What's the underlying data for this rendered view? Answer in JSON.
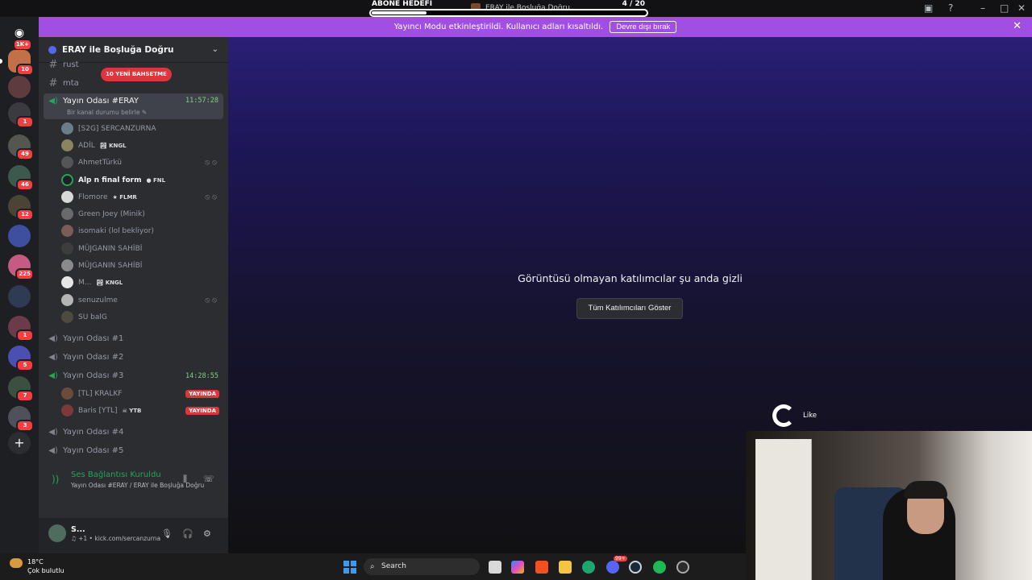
{
  "overlay": {
    "goal_label": "ABONE HEDEFİ",
    "goal_server": "ERAY ile Boşluğa Doğru",
    "goal_count": "4   / 20",
    "goal_progress": 0.2
  },
  "banner": {
    "text": "Yayıncı Modu etkinleştirildi. Kullanıcı adları kısaltıldı.",
    "button": "Devre dışı bırak",
    "close": "✕"
  },
  "rail": {
    "top_badge": "1K+",
    "badges": [
      "10",
      "1",
      "49",
      "46",
      "12",
      "225",
      "1",
      "5",
      "7",
      "3"
    ]
  },
  "sidebar": {
    "server_name": "ERAY ile Boşluğa Doğru",
    "mention_pill": "10 YENİ BAHSETME",
    "channels": [
      {
        "name": "rust"
      },
      {
        "name": "mta"
      }
    ],
    "active_voice": {
      "name": "Yayın Odası #ERAY",
      "time": "11:57:28",
      "status": "Bir kanal durumu belirle"
    },
    "users": [
      {
        "name": "[S2G] SERCANZURNA",
        "tag": ""
      },
      {
        "name": "ADİL",
        "tag": "KNGL"
      },
      {
        "name": "AhmetTürkü",
        "tag": ""
      },
      {
        "name": "Alp n final form",
        "tag": "FNL"
      },
      {
        "name": "Flomore",
        "tag": "FLMR"
      },
      {
        "name": "Green Joey (Minik)",
        "tag": ""
      },
      {
        "name": "isomaki (lol bekliyor)",
        "tag": ""
      },
      {
        "name": "MÜJGANIN SAHİBİ",
        "tag": ""
      },
      {
        "name": "MÜJGANIN SAHİBİ",
        "tag": ""
      },
      {
        "name": "M...",
        "tag": "KNGL"
      },
      {
        "name": "senuzulme",
        "tag": ""
      },
      {
        "name": "SU balG",
        "tag": ""
      }
    ],
    "voice_channels": [
      {
        "name": "Yayın Odası #1"
      },
      {
        "name": "Yayın Odası #2"
      },
      {
        "name": "Yayın Odası #3",
        "time": "14:28:55"
      },
      {
        "name": "Yayın Odası #4"
      },
      {
        "name": "Yayın Odası #5"
      }
    ],
    "room3_users": [
      {
        "name": "[TL] KRALKF",
        "live": "YAYINDA"
      },
      {
        "name": "Baris [YTL]",
        "tag": "YTB",
        "live": "YAYINDA"
      }
    ]
  },
  "voice_panel": {
    "status": "Ses Bağlantısı Kuruldu",
    "channel": "Yayın Odası #ERAY / ERAY ile Boşluğa Doğru"
  },
  "user_panel": {
    "name": "S...",
    "activity": "♫ +1 • kick.com/sercanzurna"
  },
  "stage": {
    "message": "Görüntüsü olmayan katılımcılar şu anda gizli",
    "button": "Tüm Katılımcıları Göster"
  },
  "like_overlay": {
    "label": "Like"
  },
  "taskbar": {
    "temperature": "18°C",
    "weather": "Çok bulutlu",
    "search_placeholder": "Search",
    "discord_badge": "99+"
  }
}
